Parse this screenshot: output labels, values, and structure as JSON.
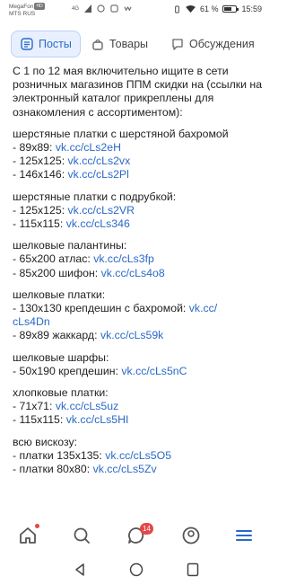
{
  "status_bar": {
    "carrier_line1": "MegaFon",
    "carrier_badge": "HD",
    "carrier_line2": "MTS RUS",
    "network": "4G",
    "battery_percent": "61 %",
    "battery_level": 0.61,
    "time": "15:59"
  },
  "tabs": [
    {
      "label": "Посты",
      "icon": "posts-icon",
      "active": true
    },
    {
      "label": "Товары",
      "icon": "shopping-bag-icon",
      "active": false
    },
    {
      "label": "Обсуждения",
      "icon": "chat-icon",
      "active": false
    }
  ],
  "post": {
    "intro": "С 1 по 12 мая включительно ищите в сети розничных магазинов ППМ скидки на (ссылки на электронный каталог прикреплены для ознакомления с ассортиментом):",
    "groups": [
      {
        "title": "шерстяные платки с шерстяной бахромой",
        "items": [
          {
            "text": "- 89х89: ",
            "link": "vk.cc/cLs2eH"
          },
          {
            "text": "- 125х125: ",
            "link": "vk.cc/cLs2vx"
          },
          {
            "text": "- 146х146: ",
            "link": "vk.cc/cLs2Pl"
          }
        ]
      },
      {
        "title": "шерстяные платки с подрубкой:",
        "items": [
          {
            "text": "- 125х125: ",
            "link": "vk.cc/cLs2VR"
          },
          {
            "text": "- 115х115: ",
            "link": "vk.cc/cLs346"
          }
        ]
      },
      {
        "title": "шелковые палантины:",
        "items": [
          {
            "text": "- 65х200 атлас: ",
            "link": "vk.cc/cLs3fp"
          },
          {
            "text": "- 85х200 шифон: ",
            "link": "vk.cc/cLs4o8"
          }
        ]
      },
      {
        "title": "шелковые платки:",
        "items": [
          {
            "text": "- 130х130 крепдешин с бахромой: ",
            "link": "vk.cc/\ncLs4Dn"
          },
          {
            "text": "- 89х89 жаккард: ",
            "link": "vk.cc/cLs59k"
          }
        ]
      },
      {
        "title": "шелковые шарфы:",
        "items": [
          {
            "text": "- 50х190 крепдешин: ",
            "link": "vk.cc/cLs5nC"
          }
        ]
      },
      {
        "title": "хлопковые платки:",
        "items": [
          {
            "text": "- 71х71: ",
            "link": "vk.cc/cLs5uz"
          },
          {
            "text": "- 115х115: ",
            "link": "vk.cc/cLs5HI"
          }
        ]
      },
      {
        "title": "всю вискозу:",
        "items": [
          {
            "text": "- платки 135х135: ",
            "link": "vk.cc/cLs5O5"
          },
          {
            "text": "- платки 80х80: ",
            "link": "vk.cc/cLs5Zv"
          }
        ]
      }
    ]
  },
  "bottom_nav": {
    "items": [
      {
        "name": "home-icon"
      },
      {
        "name": "search-icon"
      },
      {
        "name": "messages-icon"
      },
      {
        "name": "profile-icon"
      },
      {
        "name": "menu-icon"
      }
    ],
    "messages_badge": "14"
  },
  "colors": {
    "accent": "#2a69c7",
    "active_tab_bg": "#e8f0ff",
    "badge": "#e64646"
  }
}
